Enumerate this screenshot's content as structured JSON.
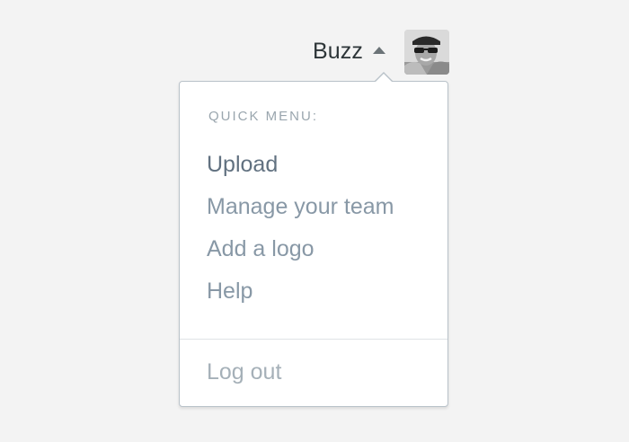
{
  "header": {
    "username": "Buzz",
    "caret_icon": "caret-up-icon",
    "avatar_icon": "user-avatar"
  },
  "menu": {
    "heading": "QUICK MENU:",
    "items": [
      {
        "label": "Upload"
      },
      {
        "label": "Manage your team"
      },
      {
        "label": "Add a logo"
      },
      {
        "label": "Help"
      }
    ],
    "logout_label": "Log out"
  },
  "colors": {
    "background": "#f3f3f3",
    "menu_border": "#b9c2c9",
    "item_text": "#8898a6",
    "item_text_hover": "#617180",
    "logout_text": "#a5b0b8"
  }
}
